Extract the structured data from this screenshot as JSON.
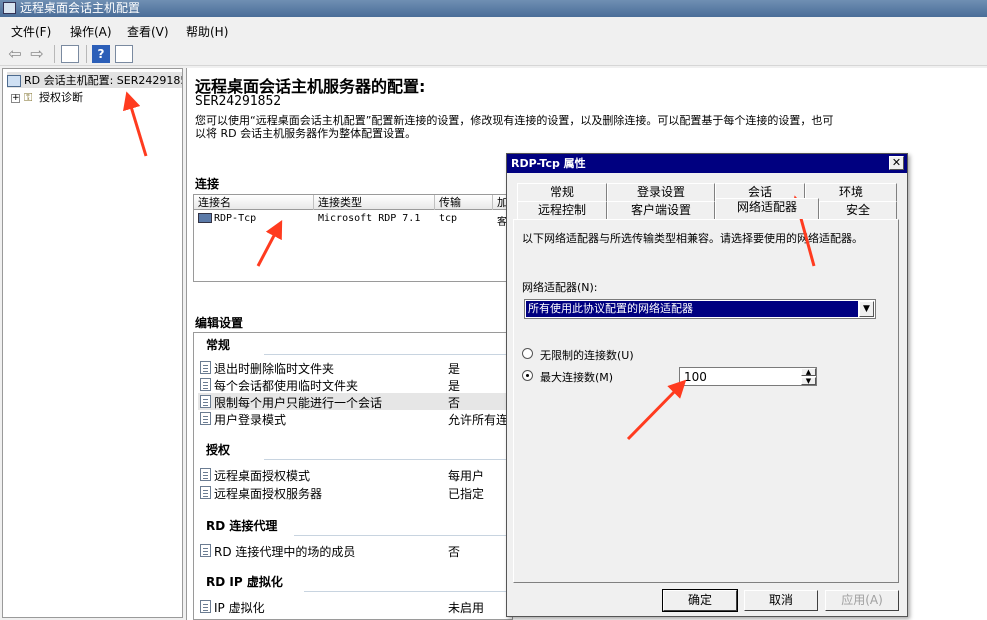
{
  "window": {
    "title": "远程桌面会话主机配置"
  },
  "menu": [
    "文件(F)",
    "操作(A)",
    "查看(V)",
    "帮助(H)"
  ],
  "tree": {
    "root": "RD 会话主机配置: SER24291852",
    "child": "授权诊断"
  },
  "main": {
    "title": "远程桌面会话主机服务器的配置:",
    "server": "SER24291852",
    "desc": "您可以使用“远程桌面会话主机配置”配置新连接的设置，修改现有连接的设置，以及删除连接。可以配置基于每个连接的设置，也可以将 RD 会话主机服务器作为整体配置设置。",
    "conn_label": "连接",
    "conn_headers": [
      "连接名",
      "连接类型",
      "传输",
      "加"
    ],
    "conn_row": [
      "RDP-Tcp",
      "Microsoft RDP 7.1",
      "tcp",
      "客"
    ],
    "edit_label": "编辑设置",
    "groups": [
      {
        "title": "常规",
        "items": [
          {
            "name": "退出时删除临时文件夹",
            "value": "是"
          },
          {
            "name": "每个会话都使用临时文件夹",
            "value": "是"
          },
          {
            "name": "限制每个用户只能进行一个会话",
            "value": "否"
          },
          {
            "name": "用户登录模式",
            "value": "允许所有连"
          }
        ]
      },
      {
        "title": "授权",
        "items": [
          {
            "name": "远程桌面授权模式",
            "value": "每用户"
          },
          {
            "name": "远程桌面授权服务器",
            "value": "已指定"
          }
        ]
      },
      {
        "title": "RD 连接代理",
        "items": [
          {
            "name": "RD 连接代理中的场的成员",
            "value": "否"
          }
        ]
      },
      {
        "title": "RD IP 虚拟化",
        "items": [
          {
            "name": "IP 虚拟化",
            "value": "未启用"
          }
        ]
      }
    ]
  },
  "dialog": {
    "title": "RDP-Tcp 属性",
    "tabs_row1": [
      "常规",
      "登录设置",
      "会话",
      "环境"
    ],
    "tabs_row2": [
      "远程控制",
      "客户端设置",
      "网络适配器",
      "安全"
    ],
    "desc": "以下网络适配器与所选传输类型相兼容。请选择要使用的网络适配器。",
    "adapter_label": "网络适配器(N):",
    "adapter_value": "所有使用此协议配置的网络适配器",
    "radio_unlimited": "无限制的连接数(U)",
    "radio_max": "最大连接数(M)",
    "max_value": "100",
    "ok": "确定",
    "cancel": "取消",
    "apply": "应用(A)"
  },
  "colors": {
    "annotation_arrow": "#ff3b1f",
    "selection": "#000080"
  }
}
